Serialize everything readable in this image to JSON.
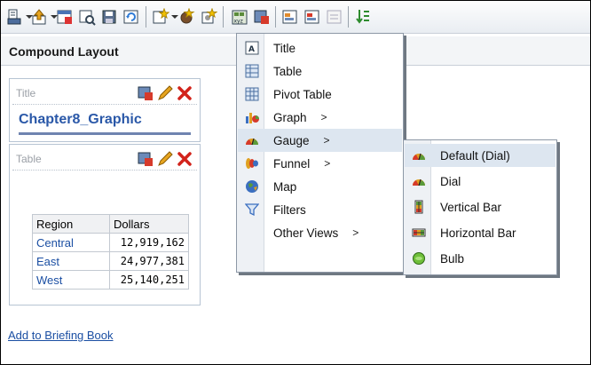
{
  "window": {
    "title": "Compound Layout"
  },
  "toolbar": {
    "buttons": [
      {
        "name": "print-icon"
      },
      {
        "name": "export-icon"
      },
      {
        "name": "schedule-icon"
      },
      {
        "name": "preview-icon"
      },
      {
        "name": "save-icon"
      },
      {
        "name": "refresh-icon"
      },
      {
        "name": "insert-view-icon"
      },
      {
        "name": "prompt-icon"
      },
      {
        "name": "settings-icon"
      },
      {
        "name": "xyz-icon"
      },
      {
        "name": "edit-icon"
      },
      {
        "name": "properties-icon"
      },
      {
        "name": "format-icon"
      },
      {
        "name": "disabled-icon"
      },
      {
        "name": "sort-icon"
      }
    ]
  },
  "views": {
    "title_view": {
      "header_label": "Title",
      "graphic_title": "Chapter8_Graphic"
    },
    "table_view": {
      "header_label": "Table",
      "columns": [
        "Region",
        "Dollars"
      ],
      "rows": [
        {
          "region": "Central",
          "dollars": "12,919,162"
        },
        {
          "region": "East",
          "dollars": "24,977,381"
        },
        {
          "region": "West",
          "dollars": "25,140,251"
        }
      ]
    }
  },
  "links": {
    "briefing_book": "Add to Briefing Book"
  },
  "new_view_menu": {
    "items": [
      {
        "label": "Title",
        "icon": "title-icon",
        "submenu": ""
      },
      {
        "label": "Table",
        "icon": "table-icon",
        "submenu": ""
      },
      {
        "label": "Pivot Table",
        "icon": "pivot-table-icon",
        "submenu": ""
      },
      {
        "label": "Graph",
        "icon": "graph-icon",
        "submenu": ">"
      },
      {
        "label": "Gauge",
        "icon": "gauge-icon",
        "submenu": ">"
      },
      {
        "label": "Funnel",
        "icon": "funnel-icon",
        "submenu": ">"
      },
      {
        "label": "Map",
        "icon": "map-icon",
        "submenu": ""
      },
      {
        "label": "Filters",
        "icon": "filters-icon",
        "submenu": ""
      },
      {
        "label": "Other Views",
        "icon": "",
        "submenu": ">"
      }
    ],
    "active": "Gauge"
  },
  "gauge_menu": {
    "items": [
      {
        "label": "Default (Dial)",
        "icon": "dial-gauge-icon"
      },
      {
        "label": "Dial",
        "icon": "dial-gauge-icon"
      },
      {
        "label": "Vertical Bar",
        "icon": "vertical-bar-gauge-icon"
      },
      {
        "label": "Horizontal Bar",
        "icon": "horizontal-bar-gauge-icon"
      },
      {
        "label": "Bulb",
        "icon": "bulb-gauge-icon"
      }
    ],
    "active": "Default (Dial)"
  },
  "colors": {
    "link": "#1b4fa3",
    "menu_highlight": "#dde6f0",
    "title_text": "#2a58a8"
  }
}
